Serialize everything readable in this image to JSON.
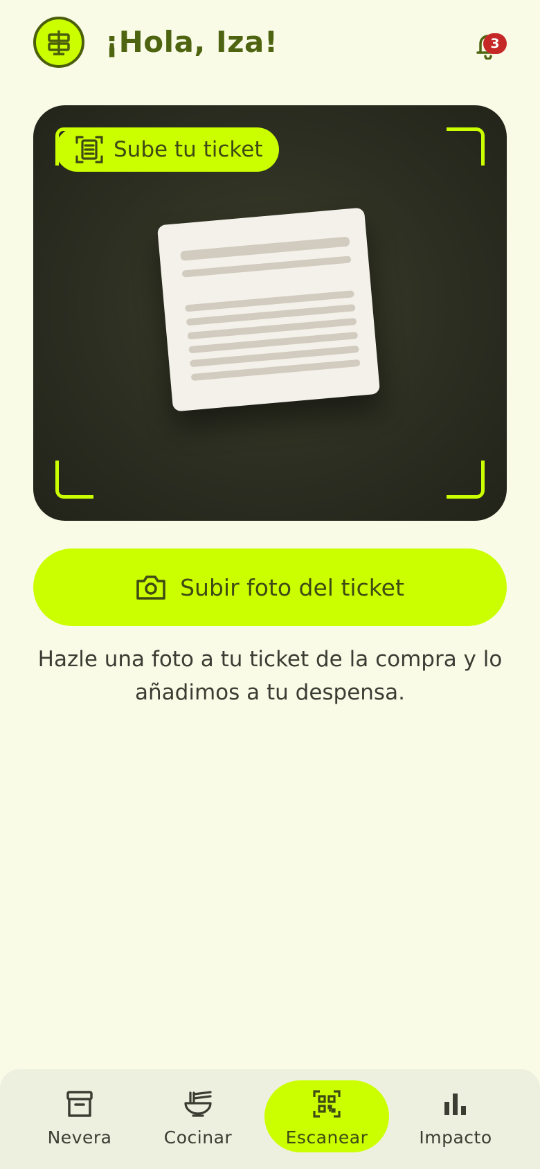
{
  "header": {
    "greeting": "¡Hola, Iza!",
    "notifications_count": "3",
    "avatar_icon": "signpost-icon",
    "bell_icon": "bell-icon"
  },
  "scanner": {
    "pill_label": "Sube tu ticket",
    "pill_icon": "receipt-scan-icon",
    "preview": "receipt-illustration"
  },
  "upload": {
    "label": "Subir foto del ticket",
    "icon": "camera-icon"
  },
  "hint": "Hazle una foto a tu ticket de la compra y lo añadimos a tu despensa.",
  "nav": {
    "items": [
      {
        "label": "Nevera",
        "icon": "archive-box-icon",
        "active": false
      },
      {
        "label": "Cocinar",
        "icon": "noodle-bowl-icon",
        "active": false
      },
      {
        "label": "Escanear",
        "icon": "qr-scan-icon",
        "active": true
      },
      {
        "label": "Impacto",
        "icon": "bar-chart-icon",
        "active": false
      }
    ]
  },
  "colors": {
    "accent": "#cbff00",
    "background": "#f9fbe7",
    "dark_panel": "#2c2e22",
    "heading": "#4e6410",
    "badge": "#c62828"
  }
}
